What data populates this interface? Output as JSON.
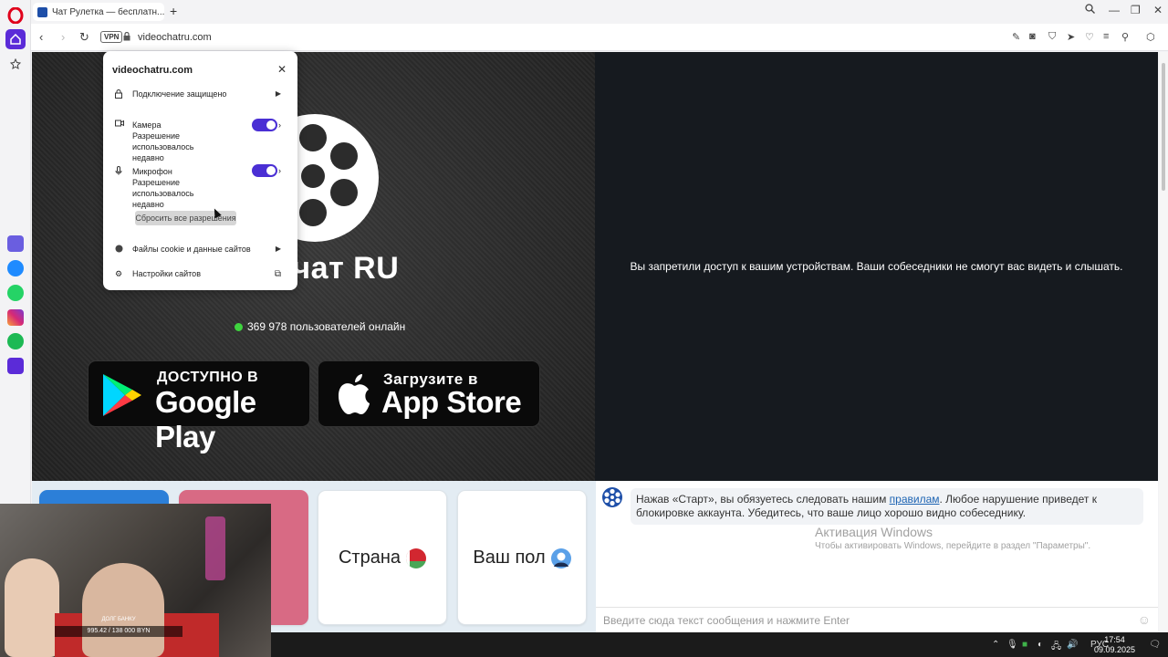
{
  "browser": {
    "tab_title": "Чат Рулетка — бесплатн...",
    "url": "videochatru.com",
    "vpn_label": "VPN"
  },
  "page": {
    "brand_text": "очат RU",
    "online_count": "369 978 пользователей онлайн",
    "denied_message": "Вы запретили доступ к вашим устройствам. Ваши собеседники не смогут вас видеть и слышать.",
    "google_play": {
      "small": "ДОСТУПНО В",
      "big": "Google Play"
    },
    "app_store": {
      "small": "Загрузите в",
      "big": "App Store"
    },
    "cards": [
      {
        "label": "Страна"
      },
      {
        "label": "Ваш пол"
      }
    ],
    "rules_prefix": "Нажав «Старт», вы обязуетесь следовать нашим ",
    "rules_link": "правилам",
    "rules_suffix": ". Любое нарушение приведет к блокировке аккаунта. Убедитесь, что ваше лицо хорошо видно собеседнику.",
    "chat_placeholder": "Введите сюда текст сообщения и нажмите Enter"
  },
  "popup": {
    "title": "videochatru.com",
    "connection": "Подключение защищено",
    "camera": {
      "name": "Камера",
      "status": "Разрешение использовалось недавно",
      "enabled": true
    },
    "microphone": {
      "name": "Микрофон",
      "status": "Разрешение использовалось недавно",
      "enabled": true
    },
    "reset_button": "Сбросить все разрешения",
    "cookies": "Файлы cookie и данные сайтов",
    "site_settings": "Настройки сайтов"
  },
  "windows_watermark": {
    "title": "Активация Windows",
    "subtitle": "Чтобы активировать Windows, перейдите в раздел \"Параметры\"."
  },
  "stream_overlay": {
    "hud_title": "ДОЛГ БАНКУ",
    "hud_value": "995.42 / 138 000 BYN"
  },
  "taskbar": {
    "lang": "РУС",
    "time": "17:54",
    "date": "09.09.2025"
  },
  "colors": {
    "accent": "#5b2bd8",
    "toggle": "#4a2fd4",
    "online_dot": "#3fd43f",
    "link": "#1d64b3"
  }
}
